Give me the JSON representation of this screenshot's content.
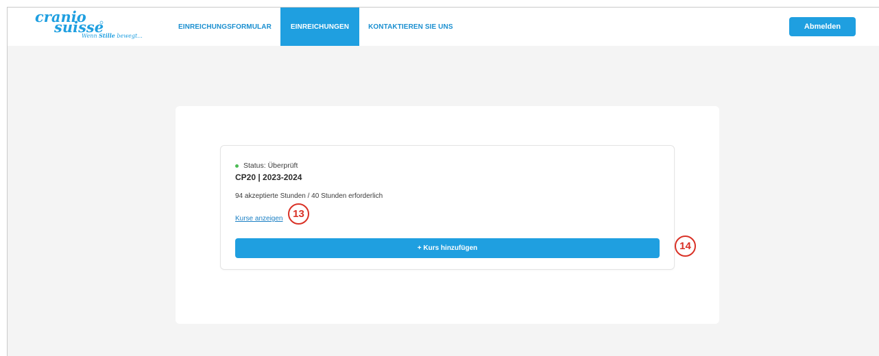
{
  "brand": {
    "logo_top": "cranio",
    "logo_bottom": "suisse",
    "tagline_pre": "Wenn ",
    "tagline_bold": "Stille",
    "tagline_post": " bewegt...",
    "logo_color": "#1f9fe0"
  },
  "nav": {
    "items": [
      {
        "label": "EINREICHUNGSFORMULAR",
        "active": false
      },
      {
        "label": "EINREICHUNGEN",
        "active": true
      },
      {
        "label": "KONTAKTIEREN SIE UNS",
        "active": false
      }
    ],
    "logout_label": "Abmelden"
  },
  "submission": {
    "status": "Status: Überprüft",
    "status_color": "#4cbb55",
    "title": "CP20 | 2023-2024",
    "hours_text": "94 akzeptierte Stunden / 40 Stunden erforderlich",
    "show_courses_label": "Kurse anzeigen",
    "add_course_label": "+ Kurs hinzufügen"
  },
  "callouts": {
    "first": "13",
    "second": "14",
    "color": "#d93025"
  },
  "colors": {
    "accent": "#1f9fe0",
    "page_bg": "#f4f4f4"
  }
}
